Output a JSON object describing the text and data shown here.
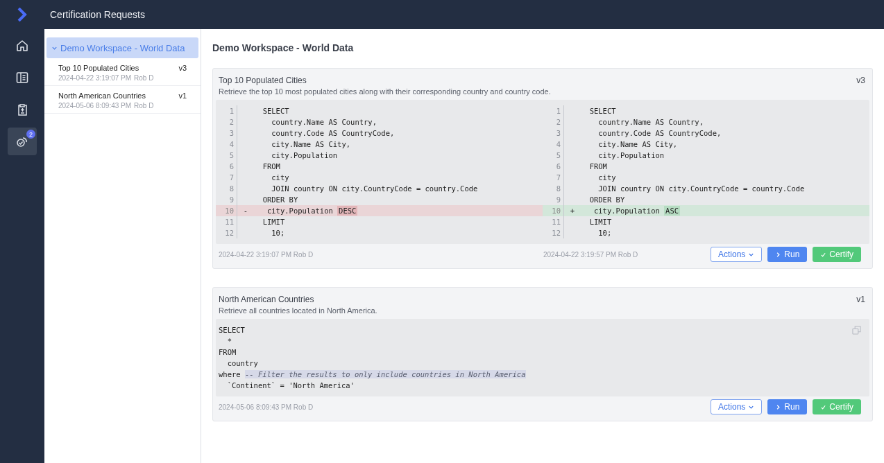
{
  "header": {
    "title": "Certification Requests"
  },
  "nav": [
    {
      "kind": "home",
      "selected": false
    },
    {
      "kind": "book",
      "selected": false
    },
    {
      "kind": "clipboard",
      "selected": false
    },
    {
      "kind": "certify",
      "selected": true,
      "badge": "2"
    }
  ],
  "sidebar": {
    "workspace": {
      "label": "Demo Workspace - World Data",
      "expanded": true
    },
    "items": [
      {
        "name": "Top 10 Populated Cities",
        "version": "v3",
        "date": "2024-04-22 3:19:07 PM",
        "author": "Rob D"
      },
      {
        "name": "North American Countries",
        "version": "v1",
        "date": "2024-05-06 8:09:43 PM",
        "author": "Rob D"
      }
    ]
  },
  "page_title": "Demo Workspace - World Data",
  "cards": [
    {
      "kind": "diff",
      "title": "Top 10 Populated Cities",
      "version": "v3",
      "description": "Retrieve the top 10 most populated cities along with their corresponding country and country code.",
      "panes": [
        {
          "date": "2024-04-22 3:19:07 PM",
          "author": "Rob D",
          "lines": [
            {
              "number": "1",
              "kind": "context",
              "text": "  SELECT"
            },
            {
              "number": "2",
              "kind": "context",
              "text": "    country.Name AS Country,"
            },
            {
              "number": "3",
              "kind": "context",
              "text": "    country.Code AS CountryCode,"
            },
            {
              "number": "4",
              "kind": "context",
              "text": "    city.Name AS City,"
            },
            {
              "number": "5",
              "kind": "context",
              "text": "    city.Population"
            },
            {
              "number": "6",
              "kind": "context",
              "text": "  FROM"
            },
            {
              "number": "7",
              "kind": "context",
              "text": "    city"
            },
            {
              "number": "8",
              "kind": "context",
              "text": "    JOIN country ON city.CountryCode = country.Code"
            },
            {
              "number": "9",
              "kind": "context",
              "text": "  ORDER BY"
            },
            {
              "number": "10",
              "kind": "removed",
              "marker": "-",
              "text": "   city.Population ",
              "highlight": "DESC"
            },
            {
              "number": "11",
              "kind": "context",
              "text": "  LIMIT"
            },
            {
              "number": "12",
              "kind": "context",
              "text": "    10;"
            }
          ]
        },
        {
          "date": "2024-04-22 3:19:57 PM",
          "author": "Rob D",
          "lines": [
            {
              "number": "1",
              "kind": "context",
              "text": "  SELECT"
            },
            {
              "number": "2",
              "kind": "context",
              "text": "    country.Name AS Country,"
            },
            {
              "number": "3",
              "kind": "context",
              "text": "    country.Code AS CountryCode,"
            },
            {
              "number": "4",
              "kind": "context",
              "text": "    city.Name AS City,"
            },
            {
              "number": "5",
              "kind": "context",
              "text": "    city.Population"
            },
            {
              "number": "6",
              "kind": "context",
              "text": "  FROM"
            },
            {
              "number": "7",
              "kind": "context",
              "text": "    city"
            },
            {
              "number": "8",
              "kind": "context",
              "text": "    JOIN country ON city.CountryCode = country.Code"
            },
            {
              "number": "9",
              "kind": "context",
              "text": "  ORDER BY"
            },
            {
              "number": "10",
              "kind": "added",
              "marker": "+",
              "text": "   city.Population ",
              "highlight": "ASC"
            },
            {
              "number": "11",
              "kind": "context",
              "text": "  LIMIT"
            },
            {
              "number": "12",
              "kind": "context",
              "text": "    10;"
            }
          ]
        }
      ],
      "buttons": [
        {
          "kind": "actions",
          "label": "Actions"
        },
        {
          "kind": "run",
          "label": "Run"
        },
        {
          "kind": "certify",
          "label": "Certify"
        }
      ]
    },
    {
      "kind": "code",
      "title": "North American Countries",
      "version": "v1",
      "description": "Retrieve all countries located in North America.",
      "date": "2024-05-06 8:09:43 PM",
      "author": "Rob D",
      "lines": [
        {
          "text": "SELECT"
        },
        {
          "text": "  *"
        },
        {
          "text": "FROM"
        },
        {
          "text": "  country"
        },
        {
          "text": "where ",
          "comment": "-- Filter the results to only include countries in North America"
        },
        {
          "text": "  `Continent` = 'North America'"
        }
      ],
      "buttons": [
        {
          "kind": "actions",
          "label": "Actions"
        },
        {
          "kind": "run",
          "label": "Run"
        },
        {
          "kind": "certify",
          "label": "Certify"
        }
      ]
    }
  ]
}
